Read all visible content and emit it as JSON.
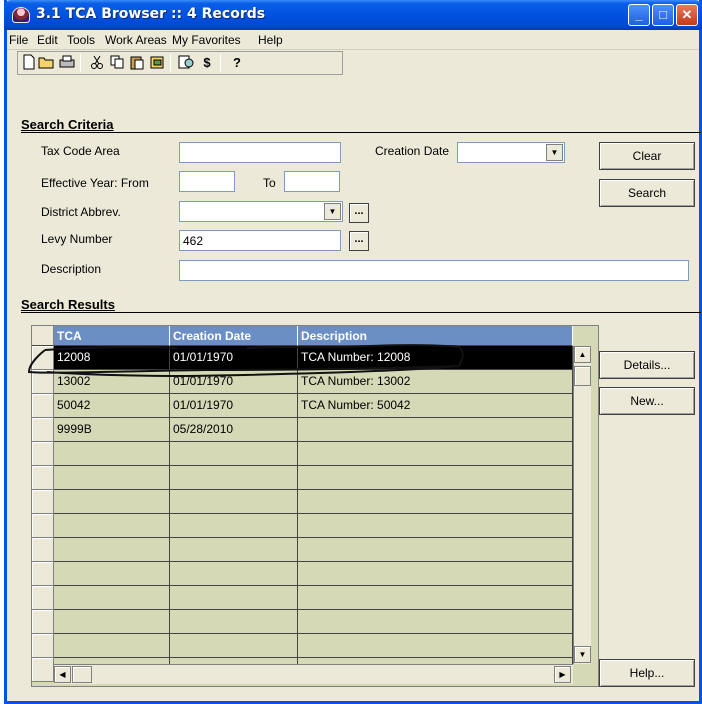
{
  "window": {
    "title": "3.1 TCA Browser  ::  4 Records",
    "controls": {
      "minimize": "_",
      "maximize": "□",
      "close": "✕"
    }
  },
  "menu": [
    "File",
    "Edit",
    "Tools",
    "Work Areas",
    "My Favorites",
    "Help"
  ],
  "toolbar": {
    "icons": [
      "new-icon",
      "open-icon",
      "print-icon",
      "cut-icon",
      "copy-icon",
      "paste-icon",
      "paste-special-icon",
      "find-icon",
      "dollar-icon",
      "help-icon"
    ],
    "dollar_label": "$",
    "help_label": "?"
  },
  "search_criteria": {
    "title": "Search Criteria",
    "tax_code_area": {
      "label": "Tax Code Area",
      "value": ""
    },
    "creation_date": {
      "label": "Creation Date",
      "value": ""
    },
    "effective_year": {
      "label": "Effective Year:  From",
      "from": "",
      "to_label": "To",
      "to": ""
    },
    "district_abbrev": {
      "label": "District Abbrev.",
      "value": ""
    },
    "levy_number": {
      "label": "Levy Number",
      "value": "462"
    },
    "description": {
      "label": "Description",
      "value": ""
    },
    "ellipsis": "..."
  },
  "buttons": {
    "clear": "Clear",
    "search": "Search",
    "details": "Details...",
    "new": "New...",
    "help": "Help..."
  },
  "search_results": {
    "title": "Search Results",
    "columns": [
      "TCA",
      "Creation Date",
      "Description"
    ],
    "rows": [
      {
        "tca": "12008",
        "date": "01/01/1970",
        "description": "TCA Number: 12008",
        "selected": true
      },
      {
        "tca": "13002",
        "date": "01/01/1970",
        "description": "TCA Number: 13002",
        "selected": false
      },
      {
        "tca": "50042",
        "date": "01/01/1970",
        "description": "TCA Number: 50042",
        "selected": false
      },
      {
        "tca": "9999B",
        "date": "05/28/2010",
        "description": "",
        "selected": false
      }
    ]
  },
  "colors": {
    "titlebar": "#0053e1",
    "grid_header": "#6b8fc4",
    "grid_body": "#d5d9b6",
    "window_bg": "#ece9d8"
  }
}
